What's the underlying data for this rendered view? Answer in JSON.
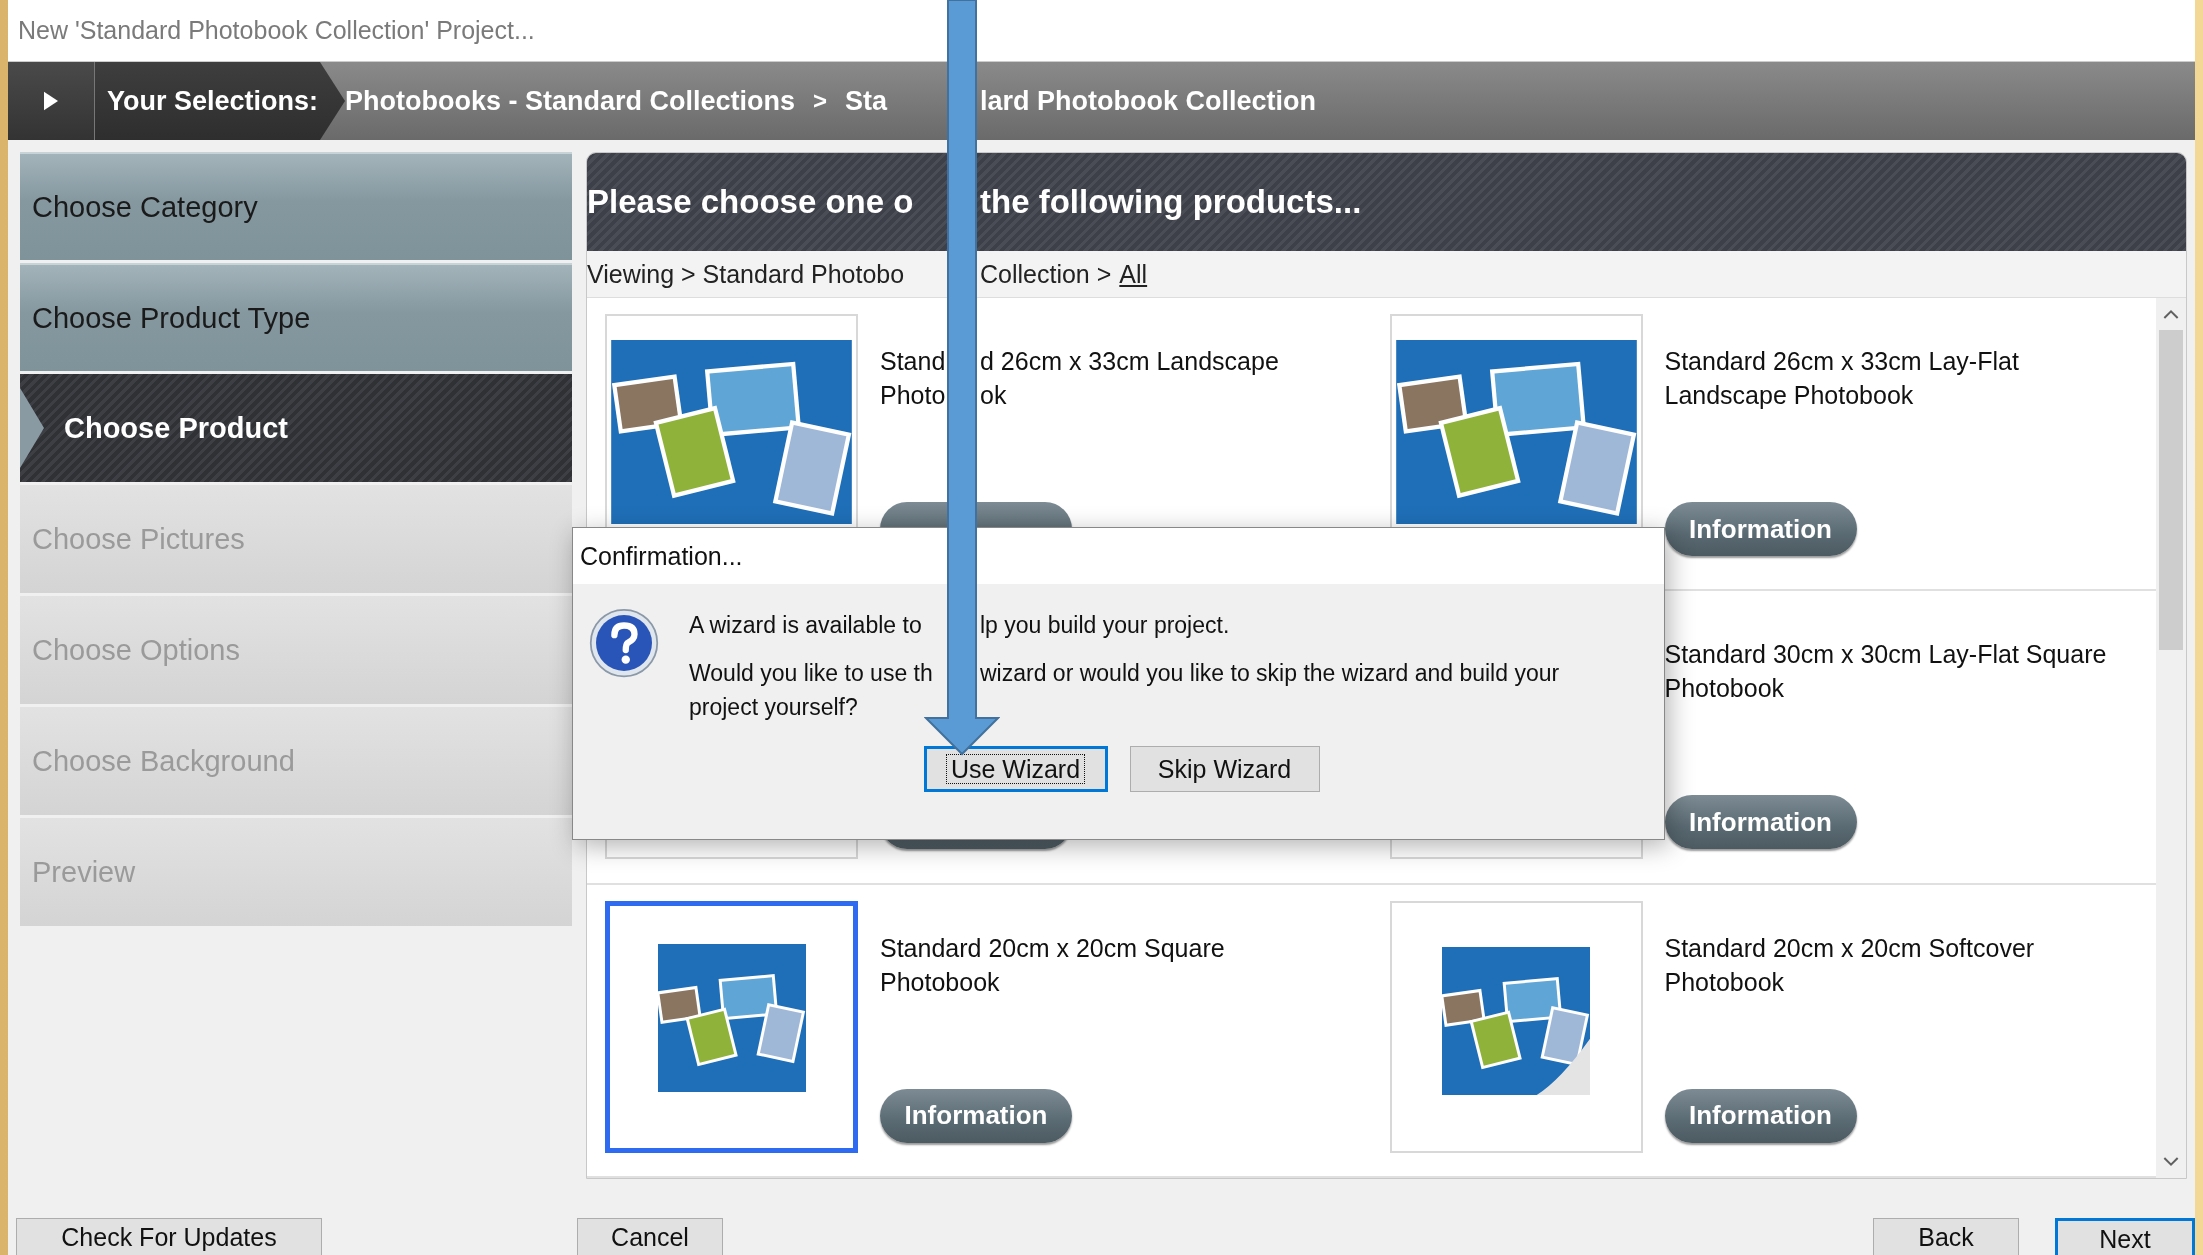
{
  "window": {
    "title": "New 'Standard Photobook Collection' Project..."
  },
  "selections": {
    "label": "Your Selections:",
    "items": [
      {
        "kind": "crumb",
        "text": "Photobooks - Standard Collections"
      },
      {
        "kind": "separator",
        "text": ">"
      },
      {
        "kind": "crumb",
        "text": "Sta"
      }
    ],
    "continuation": "lard Photobook Collection"
  },
  "steps": [
    {
      "label": "Choose Category",
      "selected": false,
      "disabled": false
    },
    {
      "label": "Choose Product Type",
      "selected": false,
      "disabled": false
    },
    {
      "label": "Choose Product",
      "selected": true,
      "disabled": false
    },
    {
      "label": "Choose Pictures",
      "selected": false,
      "disabled": true
    },
    {
      "label": "Choose Options",
      "selected": false,
      "disabled": true
    },
    {
      "label": "Choose Background",
      "selected": false,
      "disabled": true
    },
    {
      "label": "Preview",
      "selected": false,
      "disabled": true
    }
  ],
  "heading": [
    "Please choose one o",
    "the following products..."
  ],
  "viewing": {
    "text": [
      "Viewing > Standard Photobo",
      "Collection >"
    ],
    "link": "All"
  },
  "products": [
    {
      "title": [
        [
          "Stand",
          "d 26cm x 33cm Landscape"
        ],
        [
          "Photo",
          "ok"
        ]
      ],
      "kind": "large",
      "selected": false
    },
    {
      "title": [
        [
          "Standard 26cm x 33cm Lay-Flat"
        ],
        [
          "Landscape Photobook"
        ]
      ],
      "button": "Information",
      "kind": "large",
      "selected": false
    },
    {
      "kind": "large",
      "selected": false
    },
    {
      "title": [
        [
          "Standard 30cm x 30cm Lay-Flat Square"
        ],
        [
          "Photobook"
        ]
      ],
      "button": "Information",
      "kind": "large",
      "selected": false
    },
    {
      "title": [
        [
          "Standard 20cm x 20cm Square"
        ],
        [
          "Photobook"
        ]
      ],
      "button": "Information",
      "kind": "small",
      "selected": true
    },
    {
      "title": [
        [
          "Standard 20cm x 20cm Softcover"
        ],
        [
          "Photobook"
        ]
      ],
      "button": "Information",
      "kind": "softcover",
      "selected": false
    }
  ],
  "dialog": {
    "title": "Confirmation...",
    "message": [
      "A wizard is available to",
      "lp you build your project."
    ],
    "question": [
      [
        "Would you like to use th",
        "wizard or would you like to skip the wizard and build your"
      ],
      [
        "project yourself?"
      ]
    ],
    "buttons": [
      {
        "label": "Use Wizard",
        "focused": true
      },
      {
        "label": "Skip Wizard",
        "focused": false
      }
    ]
  },
  "footer": {
    "left": [
      {
        "label": "Check For Updates",
        "default": false
      },
      {
        "label": "Cancel",
        "default": false
      }
    ],
    "right": [
      {
        "label": "Back",
        "default": false
      },
      {
        "label": "Next",
        "default": true
      }
    ]
  }
}
